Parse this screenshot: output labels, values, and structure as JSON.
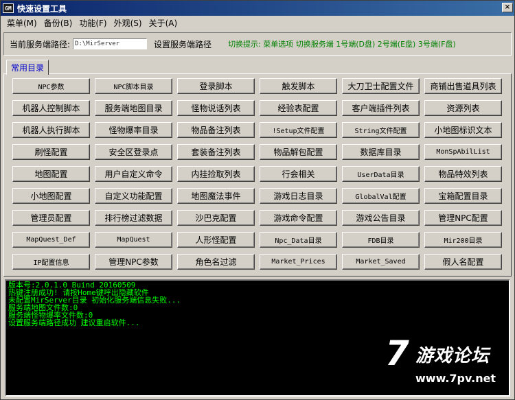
{
  "window": {
    "icon_text": "GM",
    "title": "快速设置工具",
    "close_symbol": "×"
  },
  "menu": [
    "菜单(M)",
    "备份(B)",
    "功能(F)",
    "外观(S)",
    "关于(A)"
  ],
  "path_bar": {
    "label": "当前服务端路径:",
    "value": "D:\\MirServer",
    "set_button": "设置服务端路径",
    "hint": "切换提示: 菜单选项 切换服务端 1号端(D盘) 2号端(E盘) 3号端(F盘)"
  },
  "tab": {
    "label": "常用目录"
  },
  "buttons": [
    "NPC参数",
    "NPC脚本目录",
    "登录脚本",
    "触发脚本",
    "大刀卫士配置文件",
    "商铺出售道具列表",
    "机器人控制脚本",
    "服务端地图目录",
    "怪物说话列表",
    "经验表配置",
    "客户端插件列表",
    "资源列表",
    "机器人执行脚本",
    "怪物爆率目录",
    "物品备注列表",
    "!Setup文件配置",
    "String文件配置",
    "小地图标识文本",
    "刷怪配置",
    "安全区登录点",
    "套装备注列表",
    "物品解包配置",
    "数据库目录",
    "MonSpAbilList",
    "地图配置",
    "用户自定义命令",
    "内挂捡取列表",
    "行会相关",
    "UserData目录",
    "物品特效列表",
    "小地图配置",
    "自定义功能配置",
    "地图魔法事件",
    "游戏日志目录",
    "GlobalVal配置",
    "宝箱配置目录",
    "管理员配置",
    "排行榜过滤数据",
    "沙巴克配置",
    "游戏命令配置",
    "游戏公告目录",
    "管理NPC配置",
    "MapQuest_Def",
    "MapQuest",
    "人形怪配置",
    "Npc_Data目录",
    "FDB目录",
    "Mir200目录",
    "IP配置信息",
    "管理NPC参数",
    "角色名过滤",
    "Market_Prices",
    "Market_Saved",
    "假人名配置"
  ],
  "console": {
    "lines": [
      "版本号:2.0.1.0 Buind 20160509",
      "热键注册成功! 请按Home键呼出隐藏软件",
      "未配置MirServer目录 初始化服务端信息失败...",
      "服务端地图文件数:0",
      "服务端怪物爆率文件数:0",
      "设置服务端路径成功 建议重启软件..."
    ]
  },
  "watermark": {
    "seven": "7",
    "title": "游戏论坛",
    "url": "www.7pv.net"
  }
}
